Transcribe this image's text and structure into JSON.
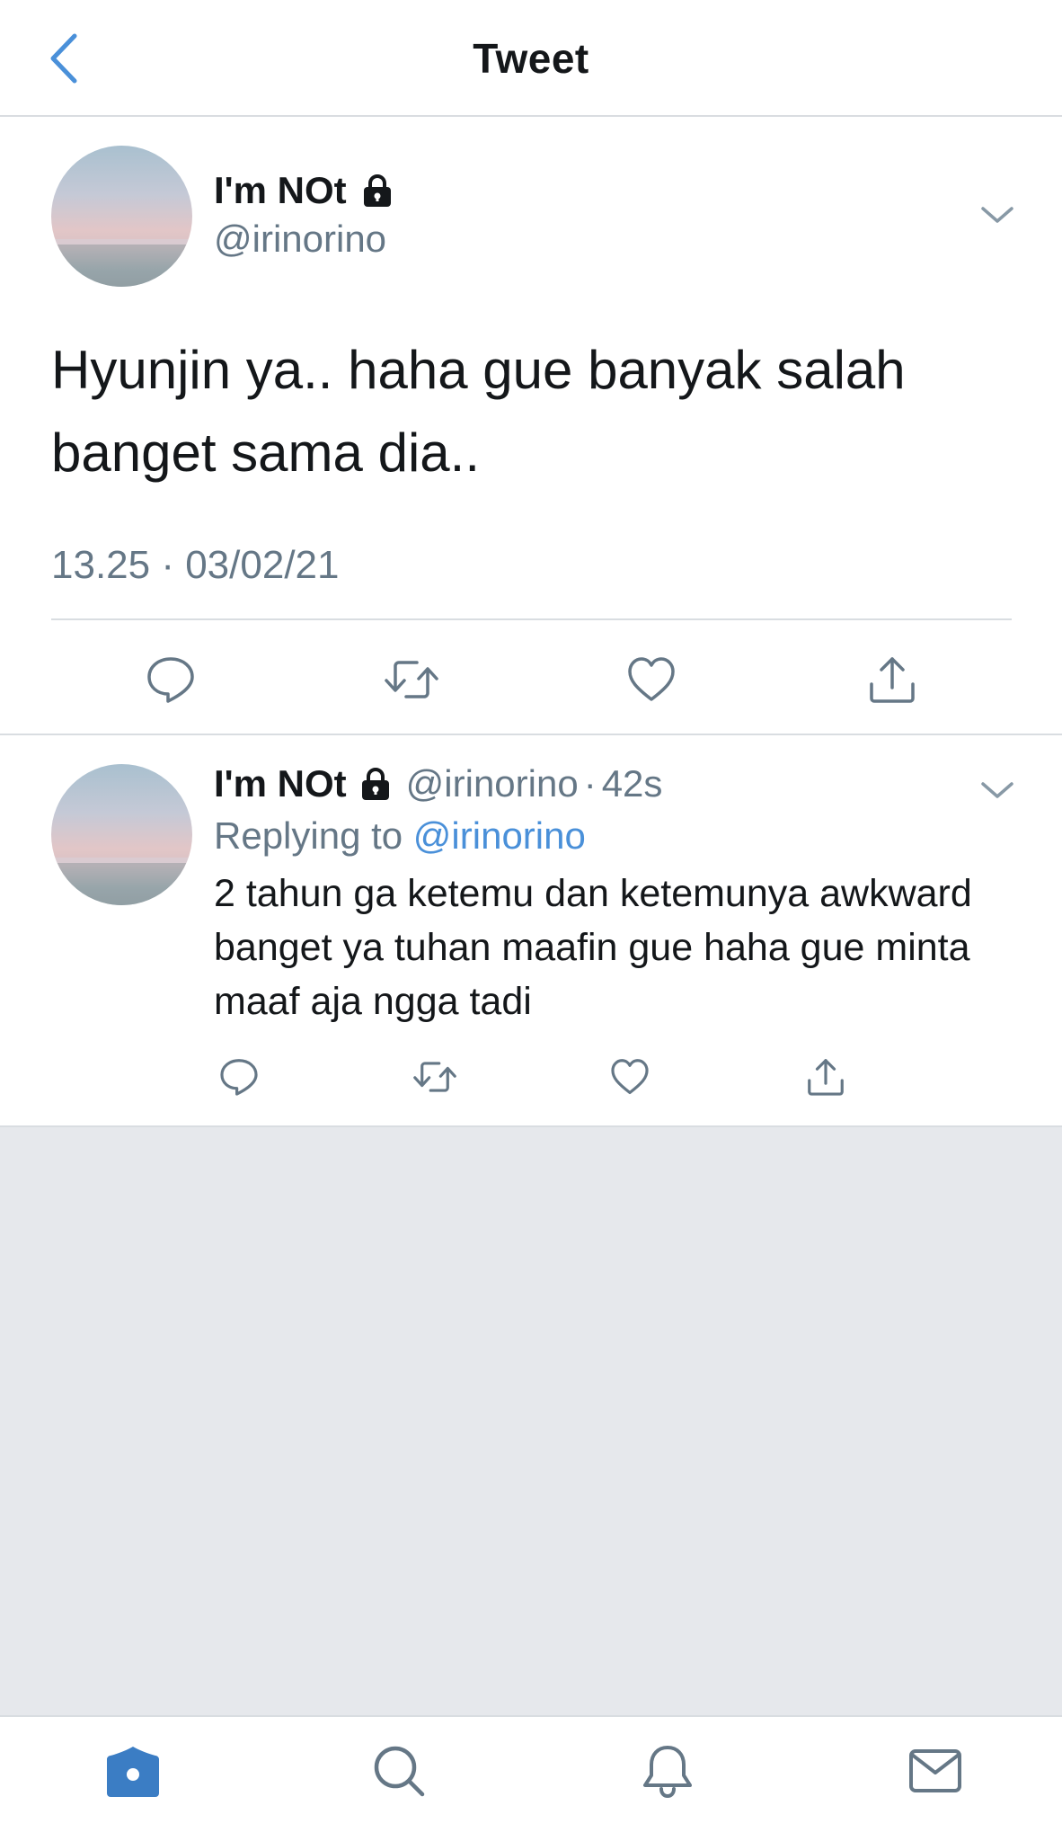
{
  "header": {
    "title": "Tweet",
    "back_icon": "chevron-left-icon"
  },
  "main_tweet": {
    "display_name": "I'm NOt",
    "protected_icon": "lock-icon",
    "handle": "@irinorino",
    "text": "Hyunjin ya.. haha gue banyak salah banget sama dia..",
    "timestamp": "13.25 · 03/02/21",
    "actions": [
      "reply-icon",
      "retweet-icon",
      "like-icon",
      "share-icon"
    ]
  },
  "reply_tweet": {
    "display_name": "I'm NOt",
    "protected_icon": "lock-icon",
    "handle": "@irinorino",
    "separator": "·",
    "time": "42s",
    "replying_to_label": "Replying to",
    "replying_to_handle": "@irinorino",
    "text": "2 tahun ga ketemu dan ketemunya awkward banget ya tuhan maafin gue haha gue minta maaf aja ngga tadi",
    "actions": [
      "reply-icon",
      "retweet-icon",
      "like-icon",
      "share-icon"
    ]
  },
  "tabbar": {
    "tabs": [
      "home-icon",
      "search-icon",
      "notifications-icon",
      "messages-icon"
    ],
    "active": "home-icon"
  },
  "colors": {
    "accent": "#4a90d9",
    "secondary_text": "#657786",
    "primary_text": "#14171a",
    "divider": "#d9dde1",
    "empty_background": "#e6e8ec"
  }
}
